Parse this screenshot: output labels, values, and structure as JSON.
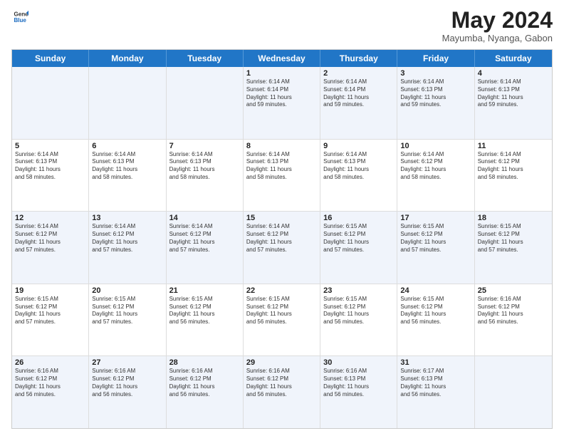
{
  "header": {
    "logo_line1": "General",
    "logo_line2": "Blue",
    "month_year": "May 2024",
    "location": "Mayumba, Nyanga, Gabon"
  },
  "days_of_week": [
    "Sunday",
    "Monday",
    "Tuesday",
    "Wednesday",
    "Thursday",
    "Friday",
    "Saturday"
  ],
  "rows": [
    [
      {
        "day": "",
        "detail": ""
      },
      {
        "day": "",
        "detail": ""
      },
      {
        "day": "",
        "detail": ""
      },
      {
        "day": "1",
        "detail": "Sunrise: 6:14 AM\nSunset: 6:14 PM\nDaylight: 11 hours\nand 59 minutes."
      },
      {
        "day": "2",
        "detail": "Sunrise: 6:14 AM\nSunset: 6:14 PM\nDaylight: 11 hours\nand 59 minutes."
      },
      {
        "day": "3",
        "detail": "Sunrise: 6:14 AM\nSunset: 6:13 PM\nDaylight: 11 hours\nand 59 minutes."
      },
      {
        "day": "4",
        "detail": "Sunrise: 6:14 AM\nSunset: 6:13 PM\nDaylight: 11 hours\nand 59 minutes."
      }
    ],
    [
      {
        "day": "5",
        "detail": "Sunrise: 6:14 AM\nSunset: 6:13 PM\nDaylight: 11 hours\nand 58 minutes."
      },
      {
        "day": "6",
        "detail": "Sunrise: 6:14 AM\nSunset: 6:13 PM\nDaylight: 11 hours\nand 58 minutes."
      },
      {
        "day": "7",
        "detail": "Sunrise: 6:14 AM\nSunset: 6:13 PM\nDaylight: 11 hours\nand 58 minutes."
      },
      {
        "day": "8",
        "detail": "Sunrise: 6:14 AM\nSunset: 6:13 PM\nDaylight: 11 hours\nand 58 minutes."
      },
      {
        "day": "9",
        "detail": "Sunrise: 6:14 AM\nSunset: 6:13 PM\nDaylight: 11 hours\nand 58 minutes."
      },
      {
        "day": "10",
        "detail": "Sunrise: 6:14 AM\nSunset: 6:12 PM\nDaylight: 11 hours\nand 58 minutes."
      },
      {
        "day": "11",
        "detail": "Sunrise: 6:14 AM\nSunset: 6:12 PM\nDaylight: 11 hours\nand 58 minutes."
      }
    ],
    [
      {
        "day": "12",
        "detail": "Sunrise: 6:14 AM\nSunset: 6:12 PM\nDaylight: 11 hours\nand 57 minutes."
      },
      {
        "day": "13",
        "detail": "Sunrise: 6:14 AM\nSunset: 6:12 PM\nDaylight: 11 hours\nand 57 minutes."
      },
      {
        "day": "14",
        "detail": "Sunrise: 6:14 AM\nSunset: 6:12 PM\nDaylight: 11 hours\nand 57 minutes."
      },
      {
        "day": "15",
        "detail": "Sunrise: 6:14 AM\nSunset: 6:12 PM\nDaylight: 11 hours\nand 57 minutes."
      },
      {
        "day": "16",
        "detail": "Sunrise: 6:15 AM\nSunset: 6:12 PM\nDaylight: 11 hours\nand 57 minutes."
      },
      {
        "day": "17",
        "detail": "Sunrise: 6:15 AM\nSunset: 6:12 PM\nDaylight: 11 hours\nand 57 minutes."
      },
      {
        "day": "18",
        "detail": "Sunrise: 6:15 AM\nSunset: 6:12 PM\nDaylight: 11 hours\nand 57 minutes."
      }
    ],
    [
      {
        "day": "19",
        "detail": "Sunrise: 6:15 AM\nSunset: 6:12 PM\nDaylight: 11 hours\nand 57 minutes."
      },
      {
        "day": "20",
        "detail": "Sunrise: 6:15 AM\nSunset: 6:12 PM\nDaylight: 11 hours\nand 57 minutes."
      },
      {
        "day": "21",
        "detail": "Sunrise: 6:15 AM\nSunset: 6:12 PM\nDaylight: 11 hours\nand 56 minutes."
      },
      {
        "day": "22",
        "detail": "Sunrise: 6:15 AM\nSunset: 6:12 PM\nDaylight: 11 hours\nand 56 minutes."
      },
      {
        "day": "23",
        "detail": "Sunrise: 6:15 AM\nSunset: 6:12 PM\nDaylight: 11 hours\nand 56 minutes."
      },
      {
        "day": "24",
        "detail": "Sunrise: 6:15 AM\nSunset: 6:12 PM\nDaylight: 11 hours\nand 56 minutes."
      },
      {
        "day": "25",
        "detail": "Sunrise: 6:16 AM\nSunset: 6:12 PM\nDaylight: 11 hours\nand 56 minutes."
      }
    ],
    [
      {
        "day": "26",
        "detail": "Sunrise: 6:16 AM\nSunset: 6:12 PM\nDaylight: 11 hours\nand 56 minutes."
      },
      {
        "day": "27",
        "detail": "Sunrise: 6:16 AM\nSunset: 6:12 PM\nDaylight: 11 hours\nand 56 minutes."
      },
      {
        "day": "28",
        "detail": "Sunrise: 6:16 AM\nSunset: 6:12 PM\nDaylight: 11 hours\nand 56 minutes."
      },
      {
        "day": "29",
        "detail": "Sunrise: 6:16 AM\nSunset: 6:12 PM\nDaylight: 11 hours\nand 56 minutes."
      },
      {
        "day": "30",
        "detail": "Sunrise: 6:16 AM\nSunset: 6:13 PM\nDaylight: 11 hours\nand 56 minutes."
      },
      {
        "day": "31",
        "detail": "Sunrise: 6:17 AM\nSunset: 6:13 PM\nDaylight: 11 hours\nand 56 minutes."
      },
      {
        "day": "",
        "detail": ""
      }
    ]
  ],
  "alt_rows": [
    0,
    2,
    4
  ]
}
